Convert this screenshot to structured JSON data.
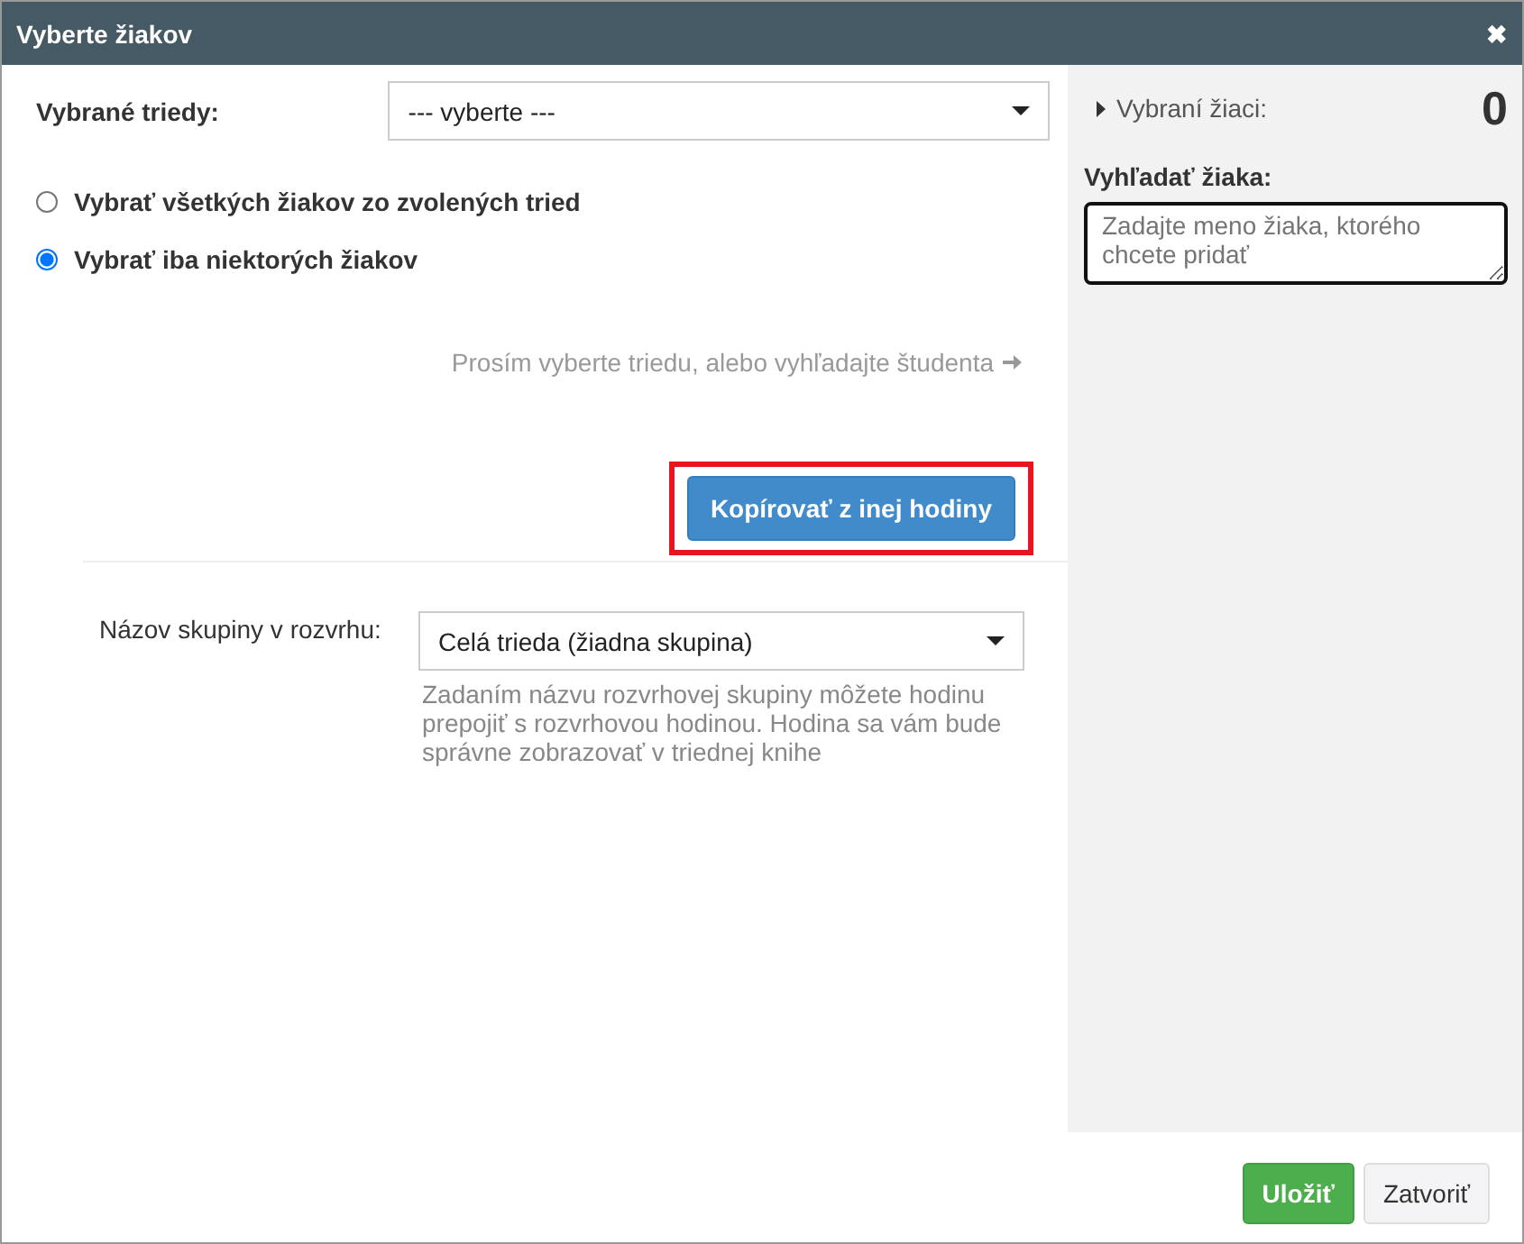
{
  "window": {
    "title": "Vyberte žiakov",
    "close": "✖"
  },
  "classes": {
    "label": "Vybrané triedy:",
    "value": "--- vyberte ---"
  },
  "options": [
    {
      "label": "Vybrať všetkých žiakov zo zvolených tried",
      "selected": false
    },
    {
      "label": "Vybrať iba niektorých žiakov",
      "selected": true
    }
  ],
  "hint": "Prosím vyberte triedu, alebo vyhľadajte študenta",
  "copy_button": {
    "label": "Kopírovať z inej hodiny",
    "highlighted": true
  },
  "group": {
    "label": "Názov skupiny v rozvrhu:",
    "value": "Celá trieda (žiadna skupina)",
    "help": "Zadaním názvu rozvrhovej skupiny môžete hodinu prepojiť s rozvrhovou hodinou. Hodina sa vám bude správne zobrazovať v triednej knihe"
  },
  "side": {
    "selected_label": "Vybraní žiaci:",
    "count": "0",
    "search_label": "Vyhľadať žiaka:",
    "search_placeholder": "Zadajte meno žiaka, ktorého chcete pridať"
  },
  "buttons": [
    {
      "label": "Uložiť",
      "kind": "primary"
    },
    {
      "label": "Zatvoriť",
      "kind": "default"
    }
  ]
}
